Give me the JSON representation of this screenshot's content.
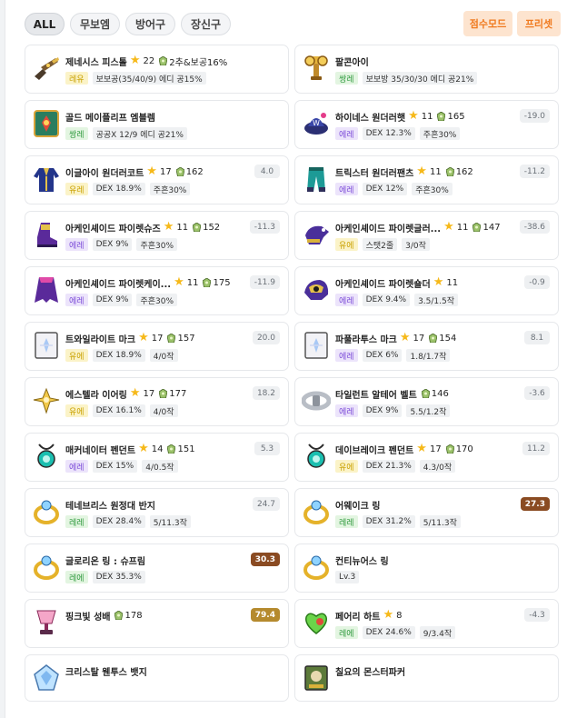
{
  "filters": {
    "all": "ALL",
    "weapon": "무보엠",
    "armor": "방어구",
    "accessory": "장신구",
    "score_mode": "점수모드",
    "preset": "프리셋"
  },
  "items": [
    {
      "name": "제네시스 피스톨",
      "star": "22",
      "potential": "2추&보공16%",
      "tags": [
        "레유",
        "보보공(35/40/9) 에디 공15%"
      ],
      "score": "",
      "grade": "unique"
    },
    {
      "name": "팔콘아이",
      "star": "",
      "potential": "",
      "tags": [
        "쌍레",
        "보보방 35/30/30 에디 공21%"
      ],
      "score": "",
      "grade": "legend"
    },
    {
      "name": "골드 메이플리프 엠블렘",
      "star": "",
      "potential": "",
      "tags": [
        "쌍레",
        "공공X 12/9 에디 공21%"
      ],
      "score": "",
      "grade": "legend"
    },
    {
      "name": "하이네스 원더러햇",
      "star": "11",
      "potential": "165",
      "tags": [
        "에레",
        "DEX 12.3%",
        "주흔30%"
      ],
      "score": "-19.0",
      "grade": "epic"
    },
    {
      "name": "이글아이 원더러코트",
      "star": "17",
      "potential": "162",
      "tags": [
        "유레",
        "DEX 18.9%",
        "주흔30%"
      ],
      "score": "4.0",
      "grade": "unique"
    },
    {
      "name": "트릭스터 원더러팬츠",
      "star": "11",
      "potential": "162",
      "tags": [
        "에레",
        "DEX 12%",
        "주흔30%"
      ],
      "score": "-11.2",
      "grade": "epic"
    },
    {
      "name": "아케인셰이드 파이렛슈즈",
      "star": "11",
      "potential": "152",
      "tags": [
        "에레",
        "DEX 9%",
        "주흔30%"
      ],
      "score": "-11.3",
      "grade": "epic"
    },
    {
      "name": "아케인셰이드 파이렛글러...",
      "star": "11",
      "potential": "147",
      "tags": [
        "유에",
        "스탯2줄",
        "3/0작"
      ],
      "score": "-38.6",
      "grade": "unique"
    },
    {
      "name": "아케인셰이드 파이렛케이...",
      "star": "11",
      "potential": "175",
      "tags": [
        "에레",
        "DEX 9%",
        "주흔30%"
      ],
      "score": "-11.9",
      "grade": "epic"
    },
    {
      "name": "아케인셰이드 파이렛숄더",
      "star": "11",
      "potential": "",
      "tags": [
        "에레",
        "DEX 9.4%",
        "3.5/1.5작"
      ],
      "score": "-0.9",
      "grade": "epic"
    },
    {
      "name": "트와일라이트 마크",
      "star": "17",
      "potential": "157",
      "tags": [
        "유에",
        "DEX 18.9%",
        "4/0작"
      ],
      "score": "20.0",
      "grade": "unique"
    },
    {
      "name": "파풀라투스 마크",
      "star": "17",
      "potential": "154",
      "tags": [
        "에레",
        "DEX 6%",
        "1.8/1.7작"
      ],
      "score": "8.1",
      "grade": "epic"
    },
    {
      "name": "에스텔라 이어링",
      "star": "17",
      "potential": "177",
      "tags": [
        "유에",
        "DEX 16.1%",
        "4/0작"
      ],
      "score": "18.2",
      "grade": "unique"
    },
    {
      "name": "타일런트 알테어 벨트",
      "star": "",
      "potential": "146",
      "tags": [
        "에레",
        "DEX 9%",
        "5.5/1.2작"
      ],
      "score": "-3.6",
      "grade": "epic"
    },
    {
      "name": "매커네이터 펜던트",
      "star": "14",
      "potential": "151",
      "tags": [
        "에레",
        "DEX 15%",
        "4/0.5작"
      ],
      "score": "5.3",
      "grade": "epic"
    },
    {
      "name": "데이브레이크 펜던트",
      "star": "17",
      "potential": "170",
      "tags": [
        "유에",
        "DEX 21.3%",
        "4.3/0작"
      ],
      "score": "11.2",
      "grade": "unique"
    },
    {
      "name": "테네브리스 원정대 반지",
      "star": "",
      "potential": "",
      "tags": [
        "레레",
        "DEX 28.4%",
        "5/11.3작"
      ],
      "score": "24.7",
      "grade": "legend"
    },
    {
      "name": "어웨이크 링",
      "star": "",
      "potential": "",
      "tags": [
        "레레",
        "DEX 31.2%",
        "5/11.3작"
      ],
      "score": "27.3",
      "grade": "legend",
      "highlight": "hi"
    },
    {
      "name": "글로리온 링 : 슈프림",
      "star": "",
      "potential": "",
      "tags": [
        "레에",
        "DEX 35.3%"
      ],
      "score": "30.3",
      "grade": "legend",
      "highlight": "hi"
    },
    {
      "name": "컨티뉴어스 링",
      "star": "",
      "potential": "",
      "tags": [
        "Lv.3"
      ],
      "score": "",
      "grade": "none"
    },
    {
      "name": "핑크빛 성배",
      "star": "",
      "potential": "178",
      "tags": [],
      "score": "79.4",
      "grade": "none",
      "highlight": "top"
    },
    {
      "name": "페어리 하트",
      "star": "8",
      "potential": "",
      "tags": [
        "레에",
        "DEX 24.6%",
        "9/3.4작"
      ],
      "score": "-4.3",
      "grade": "legend"
    },
    {
      "name": "크리스탈 웬투스 뱃지",
      "star": "",
      "potential": "",
      "tags": [],
      "score": "",
      "grade": "none"
    },
    {
      "name": "칠요의 몬스터파커",
      "star": "",
      "potential": "",
      "tags": [],
      "score": "",
      "grade": "none"
    }
  ],
  "icons": [
    "pistol-icon",
    "falcon-eye-icon",
    "emblem-icon",
    "hat-icon",
    "coat-icon",
    "pants-icon",
    "shoes-icon",
    "gloves-icon",
    "cape-icon",
    "shoulder-icon",
    "mark-icon",
    "mark-icon",
    "earring-icon",
    "belt-icon",
    "pendant-icon",
    "pendant-icon",
    "ring-icon",
    "ring-icon",
    "ring-icon",
    "ring-icon",
    "pocket-icon",
    "heart-icon",
    "badge-icon",
    "medal-icon"
  ]
}
